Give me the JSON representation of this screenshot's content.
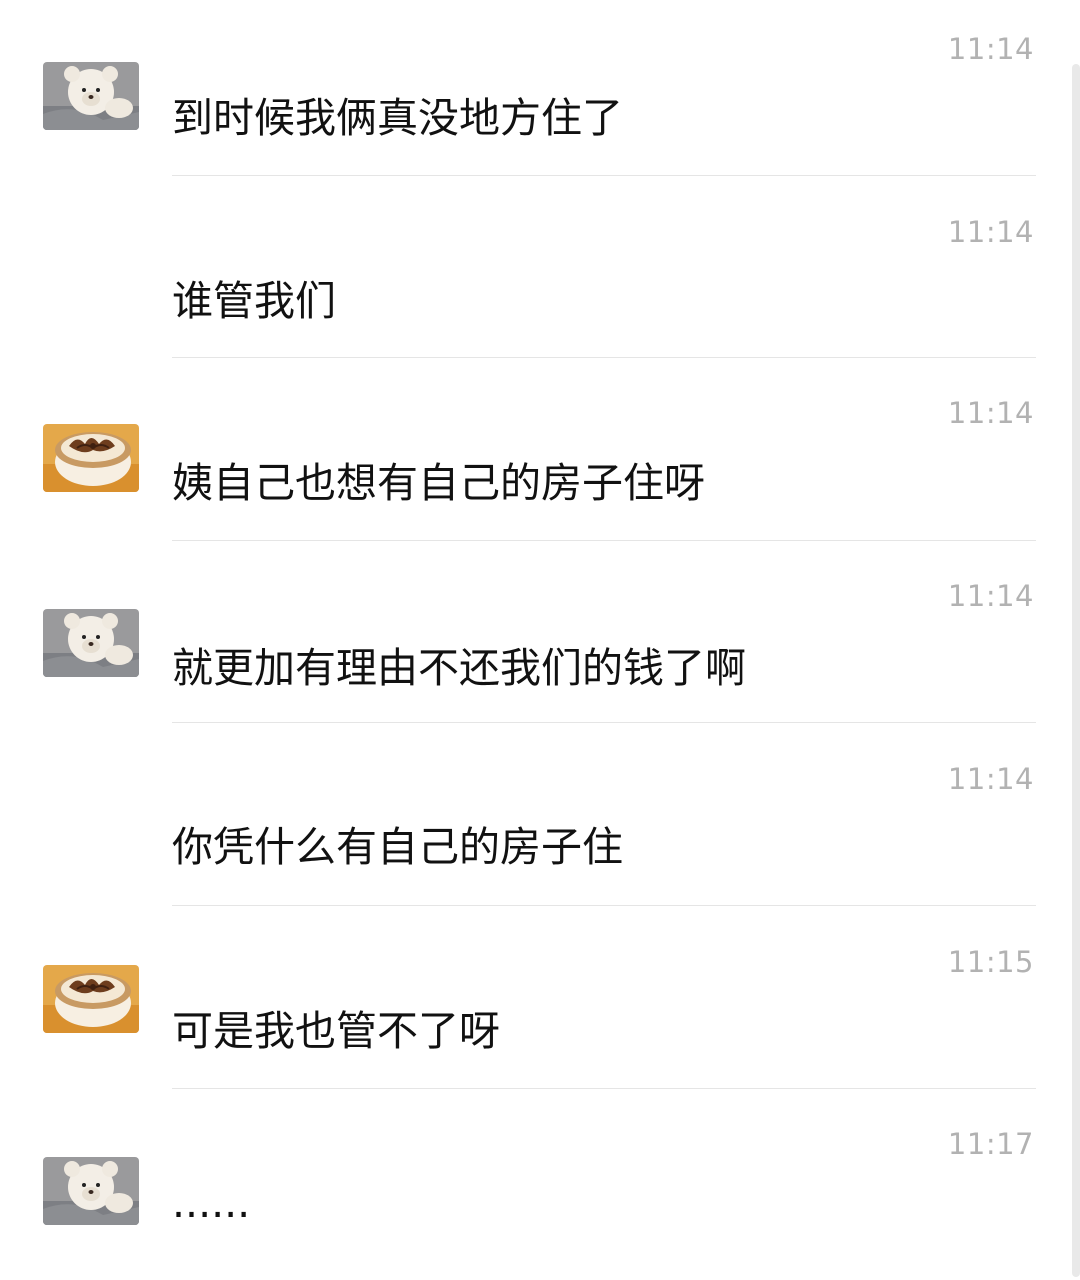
{
  "messages": [
    {
      "time": "11:14",
      "text": "到时候我俩真没地方住了",
      "avatar": "teddy-bear-avatar"
    },
    {
      "time": "11:14",
      "text": "谁管我们",
      "avatar": ""
    },
    {
      "time": "11:14",
      "text": "姨自己也想有自己的房子住呀",
      "avatar": "latte-art-avatar"
    },
    {
      "time": "11:14",
      "text": "就更加有理由不还我们的钱了啊",
      "avatar": "teddy-bear-avatar"
    },
    {
      "time": "11:14",
      "text": "你凭什么有自己的房子住",
      "avatar": ""
    },
    {
      "time": "11:15",
      "text": "可是我也管不了呀",
      "avatar": "latte-art-avatar"
    },
    {
      "time": "11:17",
      "text": "......",
      "avatar": "teddy-bear-avatar"
    }
  ]
}
